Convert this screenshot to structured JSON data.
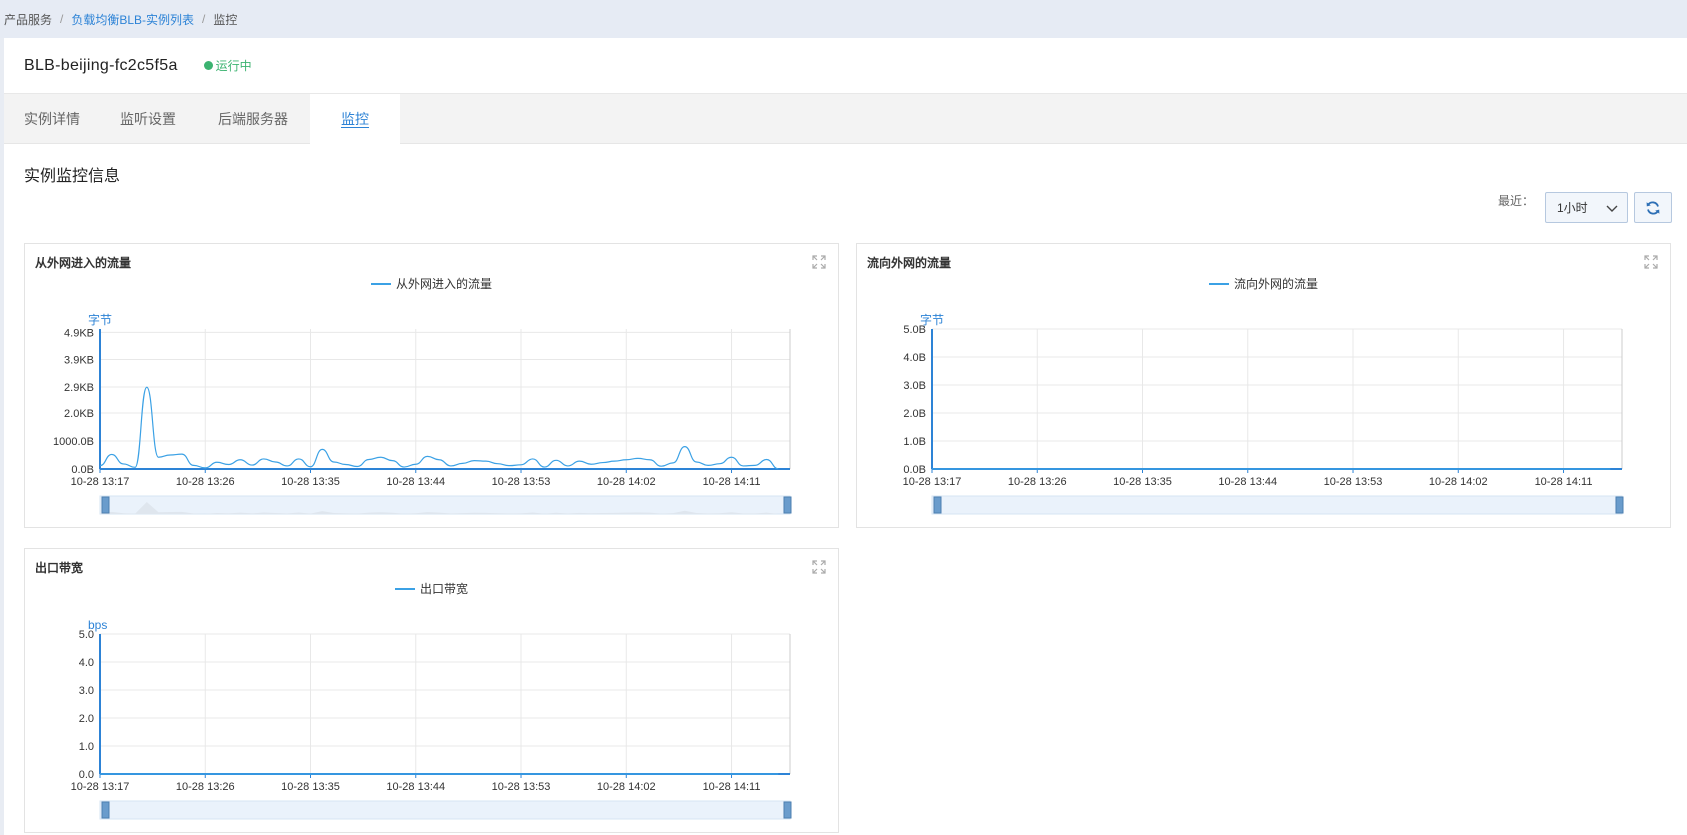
{
  "breadcrumb": {
    "items": [
      "产品服务",
      "负载均衡BLB-实例列表",
      "监控"
    ],
    "separator": "/"
  },
  "instance": {
    "name": "BLB-beijing-fc2c5f5a",
    "status": "运行中",
    "status_color": "#3cb371"
  },
  "tabs": {
    "items": [
      "实例详情",
      "监听设置",
      "后端服务器",
      "监控"
    ],
    "active": "监控"
  },
  "section": {
    "title": "实例监控信息"
  },
  "controls": {
    "range_label": "最近：",
    "range_value": "1小时",
    "refresh_icon": "refresh-icon",
    "expand_icon": "expand-icon"
  },
  "colors": {
    "accent": "#2d83d6",
    "series": "#3ba1e5"
  },
  "chart_data": [
    {
      "type": "line",
      "title": "从外网进入的流量",
      "ylabel": "字节",
      "yticks": [
        "0.0B",
        "1000.0B",
        "2.0KB",
        "2.9KB",
        "3.9KB",
        "4.9KB"
      ],
      "ytick_values": [
        0,
        1000,
        2000,
        2930,
        3910,
        4880
      ],
      "ylim": [
        0,
        5000
      ],
      "xticks": [
        "10-28 13:17",
        "10-28 13:26",
        "10-28 13:35",
        "10-28 13:44",
        "10-28 13:53",
        "10-28 14:02",
        "10-28 14:11"
      ],
      "xlim": [
        0,
        59
      ],
      "grid": true,
      "legend_position": "top-center",
      "series": [
        {
          "name": "从外网进入的流量",
          "x": [
            0,
            1,
            2,
            3,
            4,
            5,
            6,
            7,
            8,
            9,
            10,
            11,
            12,
            13,
            14,
            15,
            16,
            17,
            18,
            19,
            20,
            21,
            22,
            23,
            24,
            25,
            26,
            27,
            28,
            29,
            30,
            31,
            32,
            33,
            34,
            35,
            36,
            37,
            38,
            39,
            40,
            41,
            42,
            43,
            44,
            45,
            46,
            47,
            48,
            49,
            50,
            51,
            52,
            53,
            54,
            55,
            56,
            57,
            58
          ],
          "values": [
            120,
            520,
            180,
            60,
            2920,
            420,
            500,
            530,
            130,
            40,
            240,
            160,
            330,
            140,
            360,
            250,
            110,
            360,
            80,
            700,
            250,
            160,
            90,
            340,
            420,
            300,
            70,
            170,
            450,
            330,
            110,
            200,
            300,
            280,
            190,
            120,
            150,
            360,
            70,
            310,
            110,
            280,
            170,
            230,
            280,
            330,
            380,
            330,
            100,
            220,
            800,
            250,
            130,
            190,
            420,
            110,
            130,
            340,
            10
          ]
        }
      ]
    },
    {
      "type": "line",
      "title": "流向外网的流量",
      "ylabel": "字节",
      "yticks": [
        "0.0B",
        "1.0B",
        "2.0B",
        "3.0B",
        "4.0B",
        "5.0B"
      ],
      "ytick_values": [
        0,
        1,
        2,
        3,
        4,
        5
      ],
      "ylim": [
        0,
        5
      ],
      "xticks": [
        "10-28 13:17",
        "10-28 13:26",
        "10-28 13:35",
        "10-28 13:44",
        "10-28 13:53",
        "10-28 14:02",
        "10-28 14:11"
      ],
      "xlim": [
        0,
        59
      ],
      "grid": true,
      "legend_position": "top-center",
      "series": [
        {
          "name": "流向外网的流量",
          "x": [
            0,
            58
          ],
          "values": [
            0,
            0
          ]
        }
      ]
    },
    {
      "type": "line",
      "title": "出口带宽",
      "ylabel": "bps",
      "yticks": [
        "0.0",
        "1.0",
        "2.0",
        "3.0",
        "4.0",
        "5.0"
      ],
      "ytick_values": [
        0,
        1,
        2,
        3,
        4,
        5
      ],
      "ylim": [
        0,
        5
      ],
      "xticks": [
        "10-28 13:17",
        "10-28 13:26",
        "10-28 13:35",
        "10-28 13:44",
        "10-28 13:53",
        "10-28 14:02",
        "10-28 14:11"
      ],
      "xlim": [
        0,
        59
      ],
      "grid": true,
      "legend_position": "top-center",
      "series": [
        {
          "name": "出口带宽",
          "x": [
            0,
            58
          ],
          "values": [
            0,
            0
          ]
        }
      ]
    }
  ]
}
